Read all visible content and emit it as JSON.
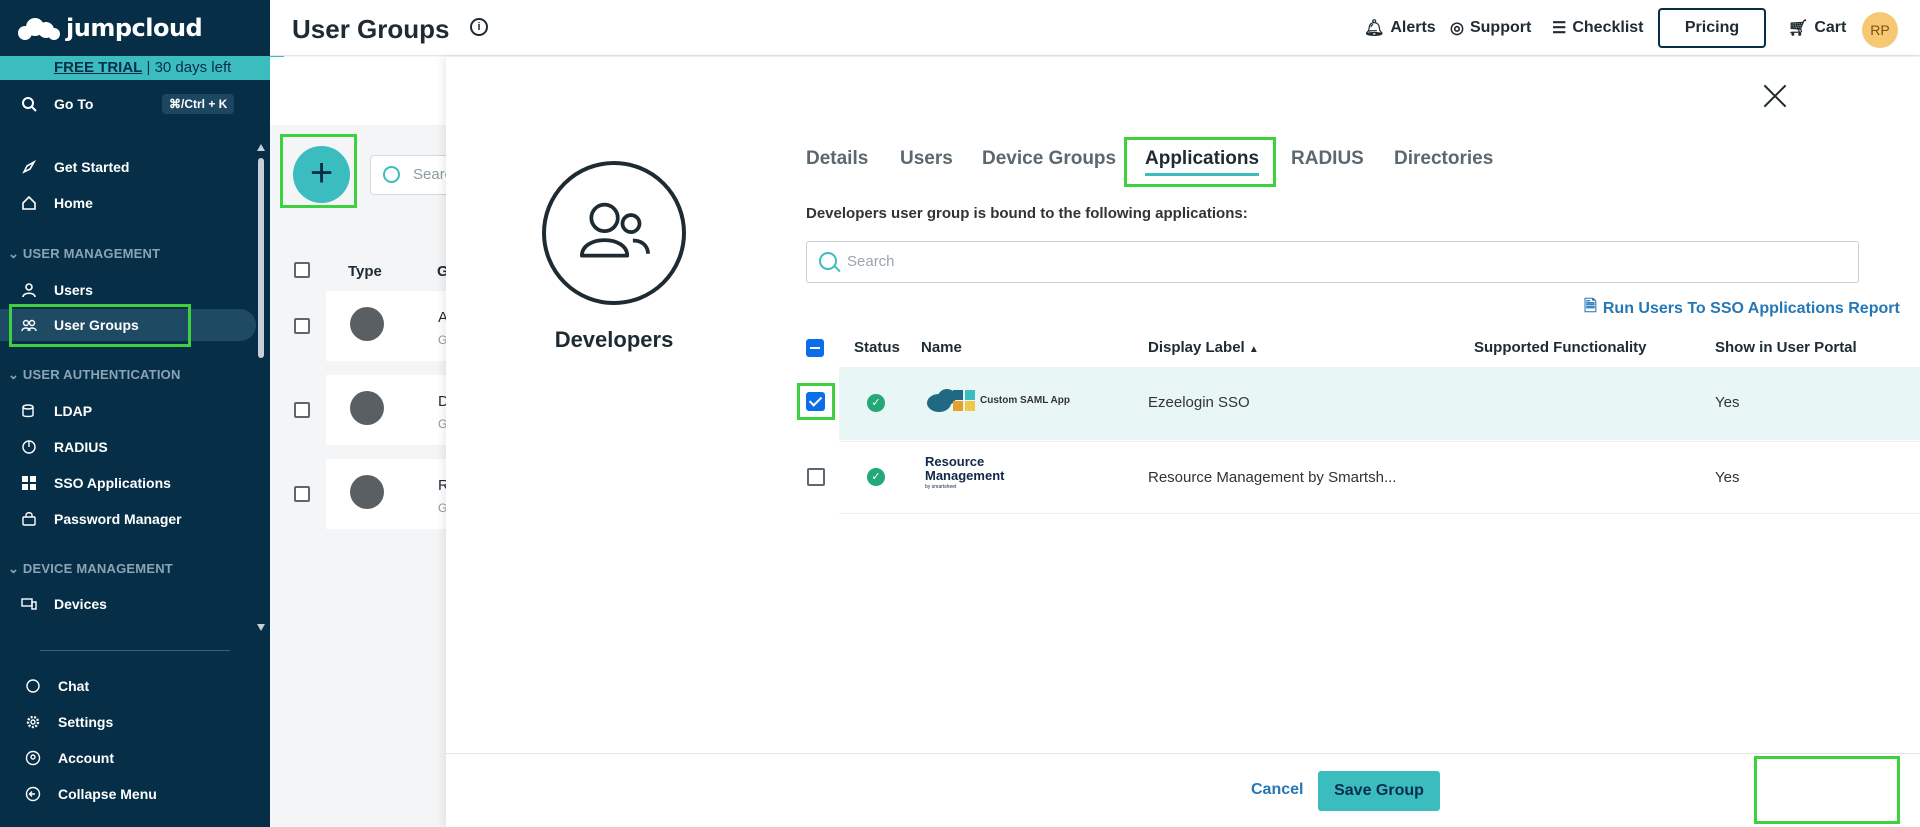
{
  "sidebar": {
    "brand": "jumpcloud",
    "trial_bold": "FREE TRIAL",
    "trial_rest": " | 30 days left",
    "goto": {
      "label": "Go To",
      "shortcut": "⌘/Ctrl + K"
    },
    "items_top": [
      {
        "label": "Get Started"
      },
      {
        "label": "Home"
      }
    ],
    "section_user_mgmt": "USER MANAGEMENT",
    "user_mgmt_items": [
      {
        "label": "Users"
      },
      {
        "label": "User Groups"
      }
    ],
    "section_user_auth": "USER AUTHENTICATION",
    "user_auth_items": [
      {
        "label": "LDAP"
      },
      {
        "label": "RADIUS"
      },
      {
        "label": "SSO Applications"
      },
      {
        "label": "Password Manager"
      }
    ],
    "section_device_mgmt": "DEVICE MANAGEMENT",
    "device_items": [
      {
        "label": "Devices"
      }
    ],
    "bottom_items": [
      {
        "label": "Chat"
      },
      {
        "label": "Settings"
      },
      {
        "label": "Account"
      },
      {
        "label": "Collapse Menu"
      }
    ]
  },
  "header": {
    "title": "User Groups",
    "links": {
      "alerts": "Alerts",
      "support": "Support",
      "checklist": "Checklist",
      "pricing": "Pricing",
      "cart": "Cart"
    },
    "avatar_initials": "RP"
  },
  "list": {
    "search_placeholder": "Searc",
    "col_type": "Type",
    "col_group": "G",
    "rows": [
      {
        "letter": "A",
        "sub": "G"
      },
      {
        "letter": "D",
        "sub": "G"
      },
      {
        "letter": "R",
        "sub": "G"
      }
    ]
  },
  "panel": {
    "group_name": "Developers",
    "tabs": [
      "Details",
      "Users",
      "Device Groups",
      "Applications",
      "RADIUS",
      "Directories"
    ],
    "active_tab": "Applications",
    "description": "Developers user group is bound to the following applications:",
    "search_placeholder": "Search",
    "report_link": "Run Users To SSO Applications Report",
    "table": {
      "headers": [
        "Status",
        "Name",
        "Display Label",
        "Supported Functionality",
        "Show in User Portal"
      ],
      "rows": [
        {
          "checked": true,
          "name_logo_text": "Custom SAML App",
          "display_label": "Ezeelogin SSO",
          "show_in_portal": "Yes"
        },
        {
          "checked": false,
          "name_logo_text": "Resource Management",
          "name_logo_sub": "by smartsheet",
          "display_label": "Resource Management by Smartsh...",
          "show_in_portal": "Yes"
        }
      ]
    },
    "cancel": "Cancel",
    "save": "Save Group"
  },
  "colors": {
    "sidebar": "#062f47",
    "accent": "#3bbdbf",
    "highlight": "#3ed03e",
    "link": "#2577b5",
    "checkbox": "#0b6ee8"
  }
}
